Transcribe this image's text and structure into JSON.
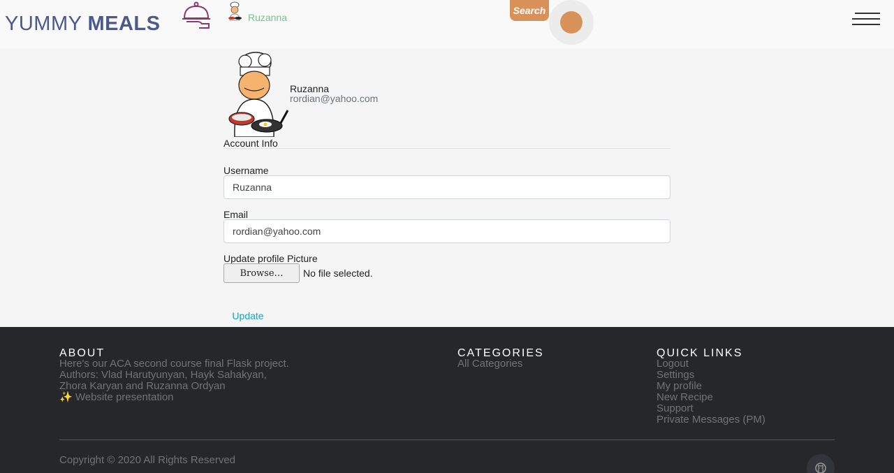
{
  "header": {
    "logo_word1": "YUMMY",
    "logo_word2": "MEALS",
    "username": "Ruzanna",
    "search_label": "Search"
  },
  "profile": {
    "name": "Ruzanna",
    "email": "rordian@yahoo.com"
  },
  "form": {
    "legend": "Account Info",
    "username_label": "Username",
    "username_value": "Ruzanna",
    "email_label": "Email",
    "email_value": "rordian@yahoo.com",
    "picture_label": "Update profile Picture",
    "browse_label": "Browse…",
    "file_status": "No file selected.",
    "submit_label": "Update"
  },
  "footer": {
    "about_title": "ABOUT",
    "about_lines": [
      "Here's our ACA second course final Flask project.",
      "Authors: Vlad Harutyunyan, Hayk Sahakyan,",
      "Zhora Karyan and Ruzanna Ordyan"
    ],
    "presentation_icon": "✨",
    "presentation_link": "Website presentation",
    "categories_title": "CATEGORIES",
    "categories_links": [
      "All Categories"
    ],
    "quick_title": "QUICK LINKS",
    "quick_links": [
      "Logout",
      "Settings",
      "My profile",
      "New Recipe",
      "Support",
      "Private Messages (PM)"
    ],
    "copyright": "Copyright © 2020 All Rights Reserved"
  },
  "colors": {
    "accent": "#d9915a",
    "logo": "#4b5a8c",
    "username": "#6cc88f",
    "link": "#17a2b8",
    "footer_bg": "#26272b"
  }
}
